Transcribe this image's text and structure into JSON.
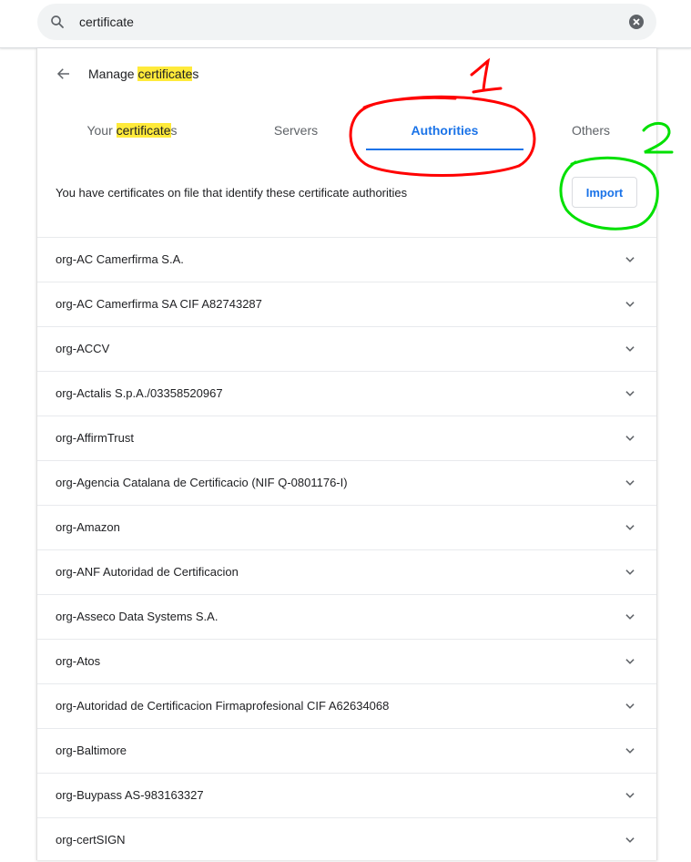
{
  "search": {
    "value": "certificate"
  },
  "header": {
    "title_highlight": "certificate",
    "title_before": "Manage ",
    "title_after": "s"
  },
  "tabs": [
    {
      "before": "Your ",
      "highlight": "certificate",
      "after": "s"
    },
    {
      "label": "Servers"
    },
    {
      "label": "Authorities",
      "active": true
    },
    {
      "label": "Others"
    }
  ],
  "description": "You have certificates on file that identify these certificate authorities",
  "import_label": "Import",
  "authorities": [
    "org-AC Camerfirma S.A.",
    "org-AC Camerfirma SA CIF A82743287",
    "org-ACCV",
    "org-Actalis S.p.A./03358520967",
    "org-AffirmTrust",
    "org-Agencia Catalana de Certificacio (NIF Q-0801176-I)",
    "org-Amazon",
    "org-ANF Autoridad de Certificacion",
    "org-Asseco Data Systems S.A.",
    "org-Atos",
    "org-Autoridad de Certificacion Firmaprofesional CIF A62634068",
    "org-Baltimore",
    "org-Buypass AS-983163327",
    "org-certSIGN"
  ],
  "annotations": {
    "one": "1",
    "two": "2"
  },
  "colors": {
    "accent": "#1a73e8",
    "highlight": "#ffea3a",
    "annot_red": "#ff0000",
    "annot_green": "#00e000"
  }
}
